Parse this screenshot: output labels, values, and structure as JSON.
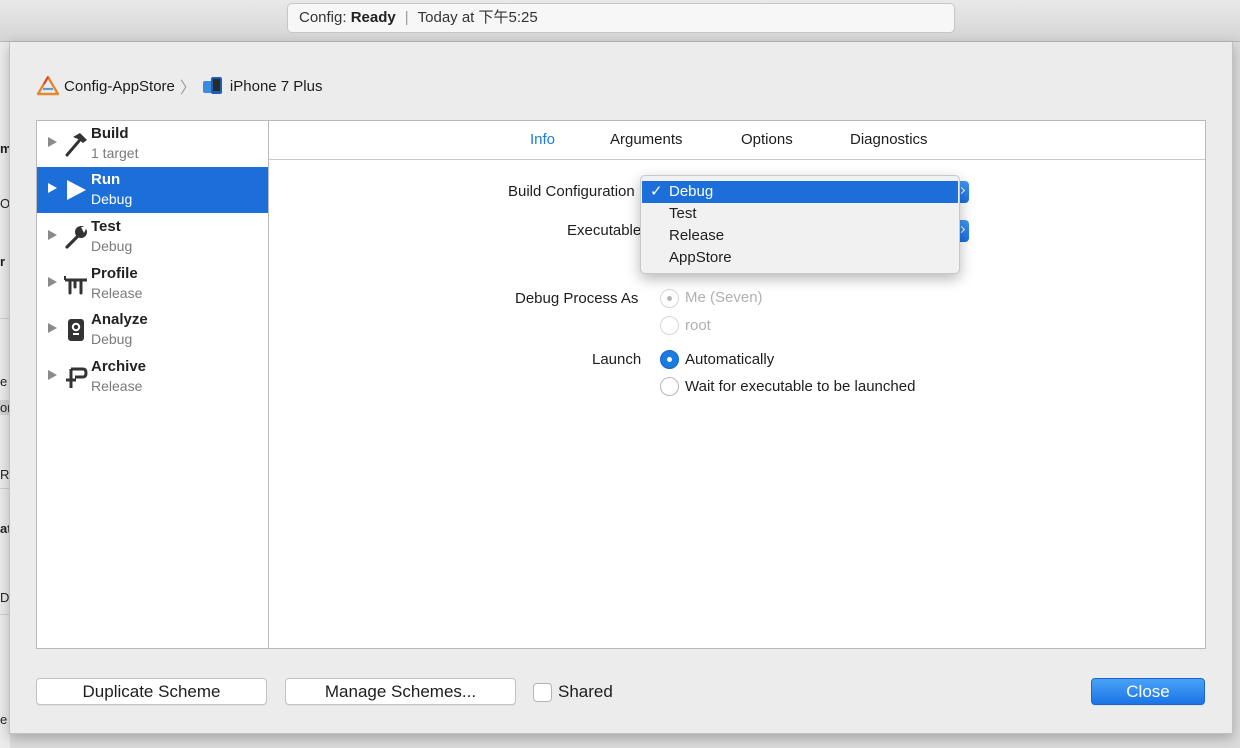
{
  "activity": {
    "project": "Config:",
    "status": "Ready",
    "time": "Today at 下午5:25"
  },
  "background_fragments": [
    "m",
    "OS",
    "r",
    "e",
    "or",
    "R",
    "at",
    "D",
    "e"
  ],
  "breadcrumb": {
    "scheme": "Config-AppStore",
    "destination": "iPhone 7 Plus"
  },
  "actions": [
    {
      "name": "Build",
      "sub": "1 target",
      "icon": "hammer-icon"
    },
    {
      "name": "Run",
      "sub": "Debug",
      "icon": "play-icon"
    },
    {
      "name": "Test",
      "sub": "Debug",
      "icon": "wrench-icon"
    },
    {
      "name": "Profile",
      "sub": "Release",
      "icon": "instruments-icon"
    },
    {
      "name": "Analyze",
      "sub": "Debug",
      "icon": "analyze-icon"
    },
    {
      "name": "Archive",
      "sub": "Release",
      "icon": "archive-icon"
    }
  ],
  "selected_action": "Run",
  "tabs": [
    "Info",
    "Arguments",
    "Options",
    "Diagnostics"
  ],
  "active_tab": "Info",
  "form": {
    "build_configuration_label": "Build Configuration",
    "executable_label": "Executable",
    "debug_process_label": "Debug Process As",
    "debug_process_options": [
      "Me (Seven)",
      "root"
    ],
    "launch_label": "Launch",
    "launch_options": [
      "Automatically",
      "Wait for executable to be launched"
    ],
    "launch_selected": "Automatically"
  },
  "dropdown": {
    "options": [
      "Debug",
      "Test",
      "Release",
      "AppStore"
    ],
    "selected": "Debug",
    "checkmark": "✓"
  },
  "buttons": {
    "duplicate": "Duplicate Scheme",
    "manage": "Manage Schemes...",
    "shared": "Shared",
    "close": "Close"
  },
  "colors": {
    "accent": "#1c6fd9",
    "tab_active": "#1a7be0"
  }
}
